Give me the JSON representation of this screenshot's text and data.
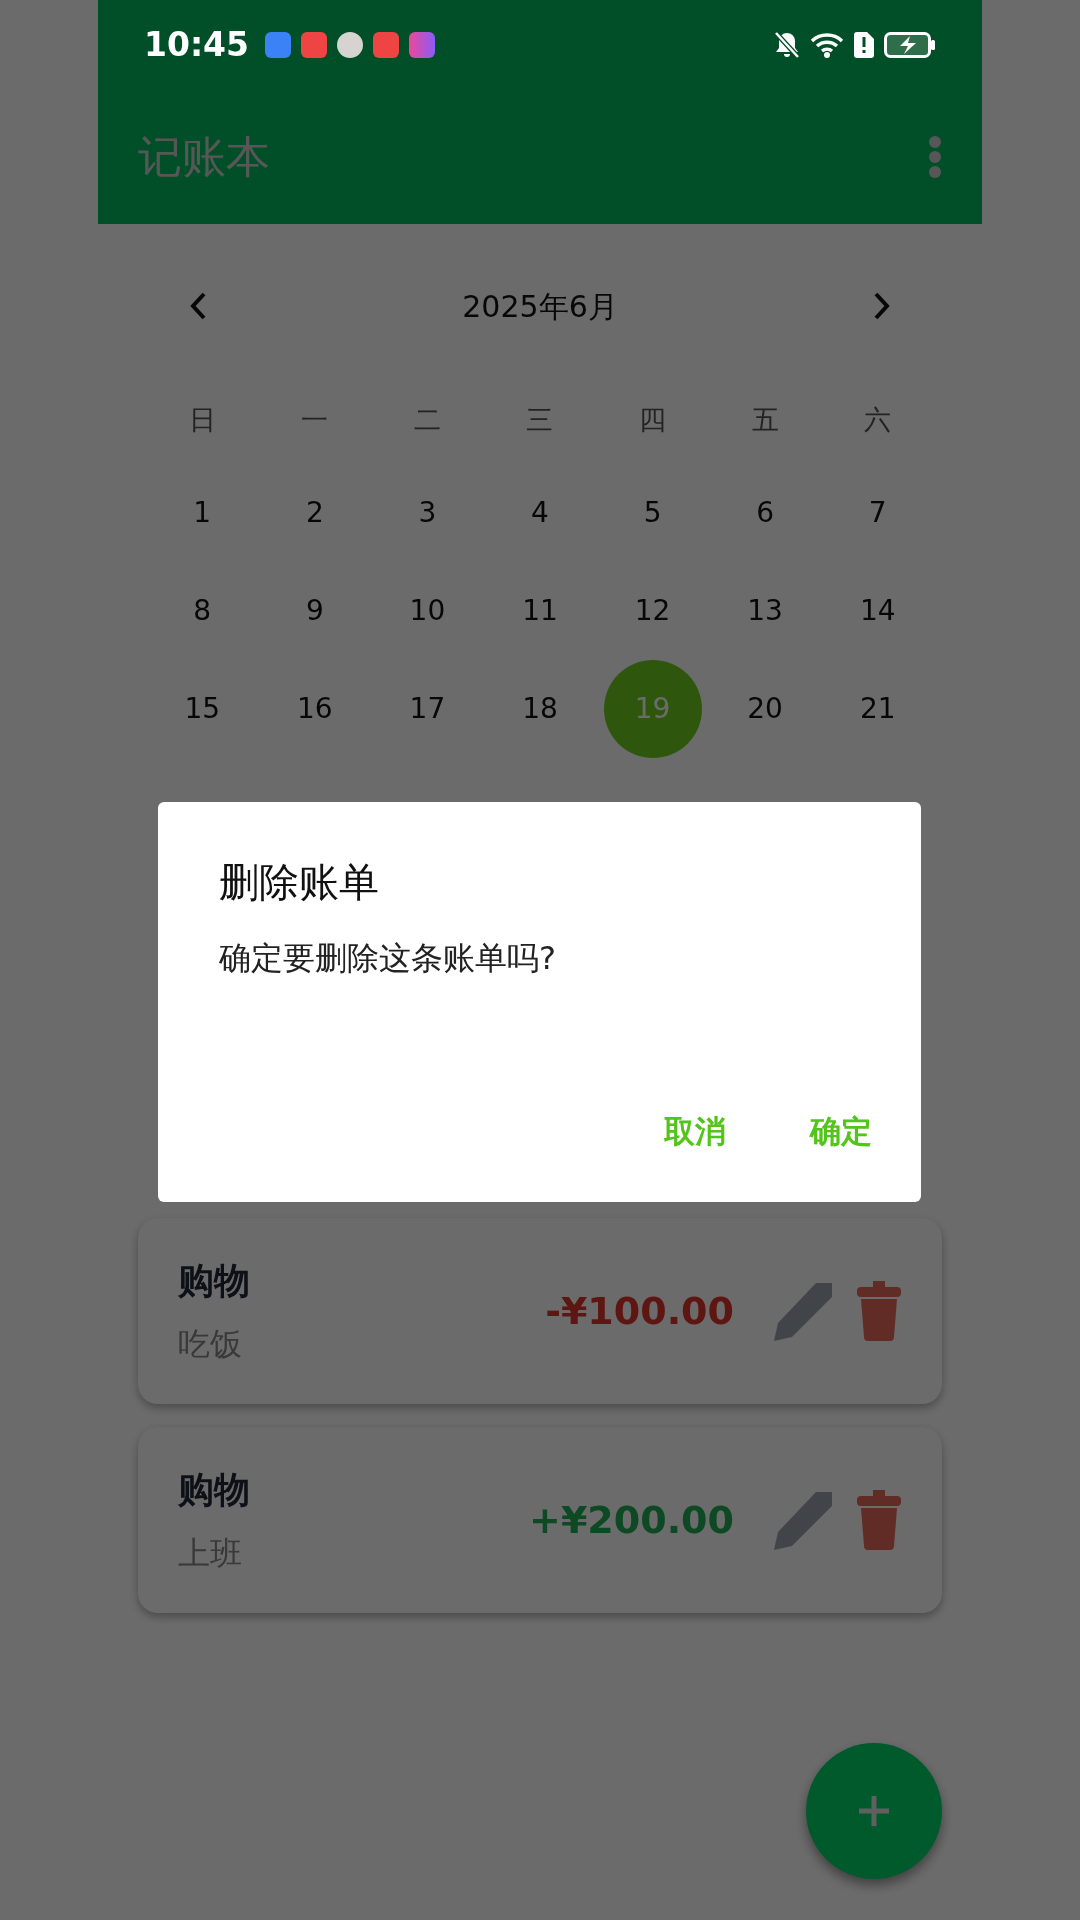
{
  "status_bar": {
    "time": "10:45"
  },
  "app_bar": {
    "title": "记账本"
  },
  "calendar": {
    "month": "2025年6月",
    "weekdays": [
      "日",
      "一",
      "二",
      "三",
      "四",
      "五",
      "六"
    ],
    "days": [
      {
        "label": "1",
        "selected": false
      },
      {
        "label": "2",
        "selected": false
      },
      {
        "label": "3",
        "selected": false
      },
      {
        "label": "4",
        "selected": false
      },
      {
        "label": "5",
        "selected": false
      },
      {
        "label": "6",
        "selected": false
      },
      {
        "label": "7",
        "selected": false
      },
      {
        "label": "8",
        "selected": false
      },
      {
        "label": "9",
        "selected": false
      },
      {
        "label": "10",
        "selected": false
      },
      {
        "label": "11",
        "selected": false
      },
      {
        "label": "12",
        "selected": false
      },
      {
        "label": "13",
        "selected": false
      },
      {
        "label": "14",
        "selected": false
      },
      {
        "label": "15",
        "selected": false
      },
      {
        "label": "16",
        "selected": false
      },
      {
        "label": "17",
        "selected": false
      },
      {
        "label": "18",
        "selected": false
      },
      {
        "label": "19",
        "selected": true
      },
      {
        "label": "20",
        "selected": false
      },
      {
        "label": "21",
        "selected": false
      }
    ]
  },
  "records": [
    {
      "category": "购物",
      "note": "吃饭",
      "amount": "-¥100.00",
      "kind": "expense"
    },
    {
      "category": "购物",
      "note": "上班",
      "amount": "+¥200.00",
      "kind": "income"
    }
  ],
  "dialog": {
    "title": "删除账单",
    "message": "确定要删除这条账单吗?",
    "buttons": [
      "取消",
      "确定"
    ]
  }
}
